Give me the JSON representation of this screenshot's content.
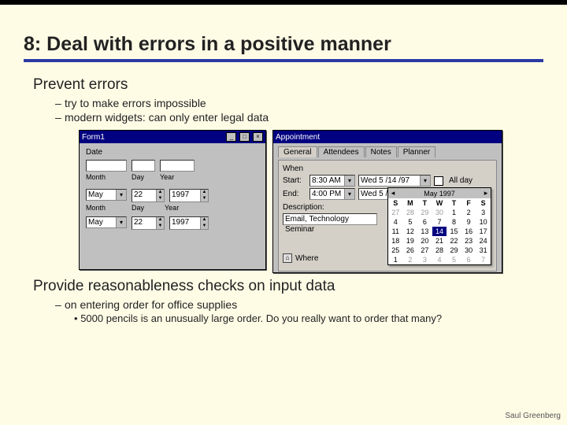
{
  "title": "8: Deal with errors in a positive manner",
  "section1": {
    "heading": "Prevent errors",
    "bullets": [
      "try to make errors impossible",
      "modern widgets: can only enter legal data"
    ]
  },
  "form1": {
    "title": "Form1",
    "date_label": "Date",
    "labels": {
      "month": "Month",
      "day": "Day",
      "year": "Year"
    },
    "row2": {
      "month": "May",
      "day": "22",
      "year": "1997"
    },
    "row3": {
      "month": "May",
      "day": "22",
      "year": "1997"
    }
  },
  "appt": {
    "title": "Appointment",
    "tabs": [
      "General",
      "Attendees",
      "Notes",
      "Planner"
    ],
    "when_label": "When",
    "start_label": "Start:",
    "end_label": "End:",
    "start_time": "8:30 AM",
    "start_date": "Wed 5 /14 /97",
    "end_time": "4:00 PM",
    "end_date": "Wed 5 /14 /97",
    "allday": "All day",
    "desc_label": "Description:",
    "desc_value": "Email, Technology Seminar",
    "where_label": "Where"
  },
  "calendar": {
    "month": "May 1997",
    "dow": [
      "S",
      "M",
      "T",
      "W",
      "T",
      "F",
      "S"
    ],
    "weeks": [
      [
        "27",
        "28",
        "29",
        "30",
        "1",
        "2",
        "3"
      ],
      [
        "4",
        "5",
        "6",
        "7",
        "8",
        "9",
        "10"
      ],
      [
        "11",
        "12",
        "13",
        "14",
        "15",
        "16",
        "17"
      ],
      [
        "18",
        "19",
        "20",
        "21",
        "22",
        "23",
        "24"
      ],
      [
        "25",
        "26",
        "27",
        "28",
        "29",
        "30",
        "31"
      ],
      [
        "1",
        "2",
        "3",
        "4",
        "5",
        "6",
        "7"
      ]
    ],
    "dim_first": 4,
    "dim_last_start": 1,
    "selected": "14"
  },
  "section2": {
    "heading": "Provide reasonableness checks on input data",
    "bullet": "on entering order for office supplies",
    "sub": "5000 pencils is an unusually large order. Do you really want to order that many?"
  },
  "footer": "Saul Greenberg"
}
